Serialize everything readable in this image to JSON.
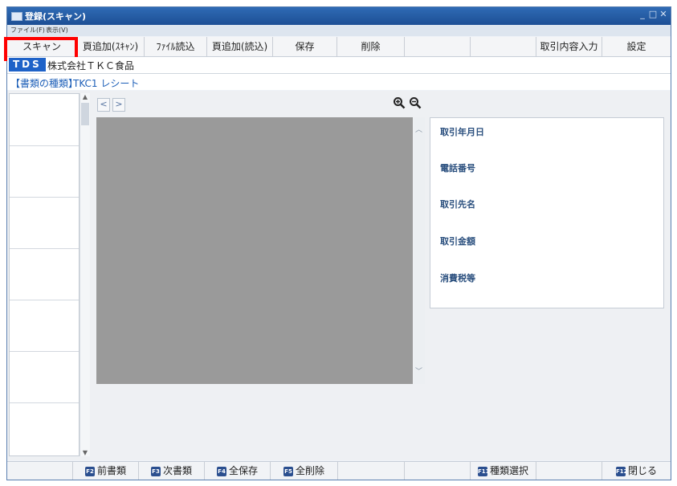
{
  "window": {
    "title": "登録(スキャン)"
  },
  "menu": {
    "file": "ファイル(F)",
    "view": "表示(V)"
  },
  "toolbar": {
    "scan": "スキャン",
    "add_page_scan": "頁追加(ｽｷｬﾝ)",
    "file_import": "ﾌｧｲﾙ読込",
    "add_page_import": "頁追加(読込)",
    "save": "保存",
    "delete": "削除",
    "transaction_input": "取引内容入力",
    "settings": "設定"
  },
  "company": {
    "badge": "TDS",
    "name": "株式会社ＴＫＣ食品"
  },
  "document_type": {
    "label": "【書類の種類】",
    "value": "TKC1 レシート"
  },
  "fields": [
    {
      "label": "取引年月日"
    },
    {
      "label": "電話番号"
    },
    {
      "label": "取引先名"
    },
    {
      "label": "取引金額"
    },
    {
      "label": "消費税等"
    }
  ],
  "footer": {
    "prev_doc": {
      "key": "F2",
      "label": "前書類"
    },
    "next_doc": {
      "key": "F3",
      "label": "次書類"
    },
    "save_all": {
      "key": "F4",
      "label": "全保存"
    },
    "delete_all": {
      "key": "F5",
      "label": "全削除"
    },
    "type_select": {
      "key": "F11",
      "label": "種類選択"
    },
    "close": {
      "key": "F12",
      "label": "閉じる"
    }
  },
  "colors": {
    "titlebar": "#2f6bb5",
    "highlight": "#ff0000",
    "badge": "#1e62c8",
    "preview": "#9a9a9a"
  }
}
